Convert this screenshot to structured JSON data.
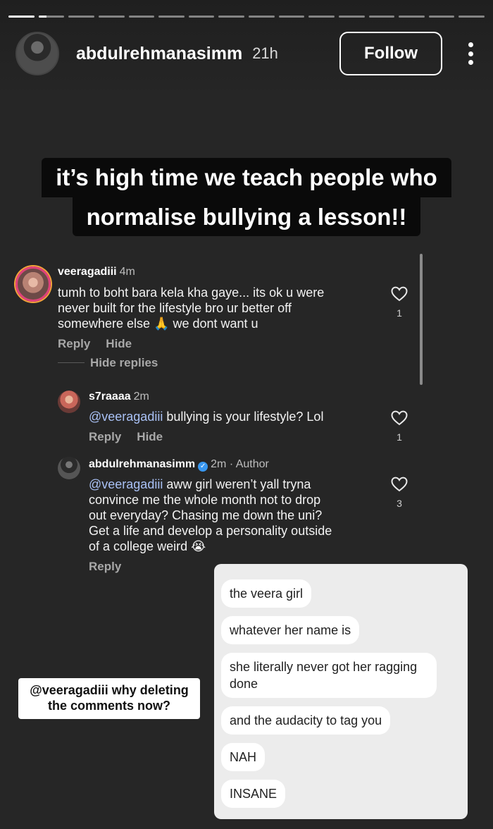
{
  "story": {
    "progress_segments": [
      1,
      0,
      0,
      0,
      0,
      0,
      0,
      0,
      0,
      0,
      0,
      0,
      0,
      0,
      0,
      0
    ],
    "progress_current_index": 1,
    "progress_current_fill": 0.3
  },
  "header": {
    "username": "abdulrehmanasimm",
    "time": "21h",
    "follow_label": "Follow"
  },
  "caption": {
    "line1": "it’s high time we teach people who",
    "line2": "normalise bullying a lesson!!"
  },
  "comments": [
    {
      "user": "veeragadiii",
      "meta": "4m",
      "text_lines": [
        "tumh to boht bara kela kha gaye... its ok u were",
        "never built for the lifestyle bro ur better off",
        "somewhere else 🙏 we dont want u"
      ],
      "likes": "1",
      "reply_label": "Reply",
      "hide_label": "Hide",
      "hide_replies_label": "Hide replies"
    },
    {
      "user": "s7raaaa",
      "meta": "2m",
      "mention": "@veeragadiii",
      "text": " bullying is your lifestyle? Lol",
      "likes": "1",
      "reply_label": "Reply",
      "hide_label": "Hide"
    },
    {
      "user": "abdulrehmanasimm",
      "meta": "2m · Author",
      "mention": "@veeragadiii",
      "text_first": " aww girl weren’t yall tryna",
      "text_lines": [
        "convince me the whole month not to drop",
        "out everyday? Chasing me down the uni?",
        "Get a life and develop a personality outside",
        "of a college weird 😭"
      ],
      "likes": "3",
      "reply_label": "Reply"
    }
  ],
  "sticker": {
    "line1": "@veeragadiii why deleting",
    "line2": "the comments now?"
  },
  "chat": {
    "messages": [
      "the veera girl",
      "whatever her name is",
      "she literally never got her ragging done",
      "and the audacity to tag you",
      "NAH",
      "INSANE"
    ]
  },
  "colors": {
    "background": "#262626",
    "mention": "#a9c1f5",
    "verified": "#3897f0",
    "chat_background": "#ececec"
  }
}
